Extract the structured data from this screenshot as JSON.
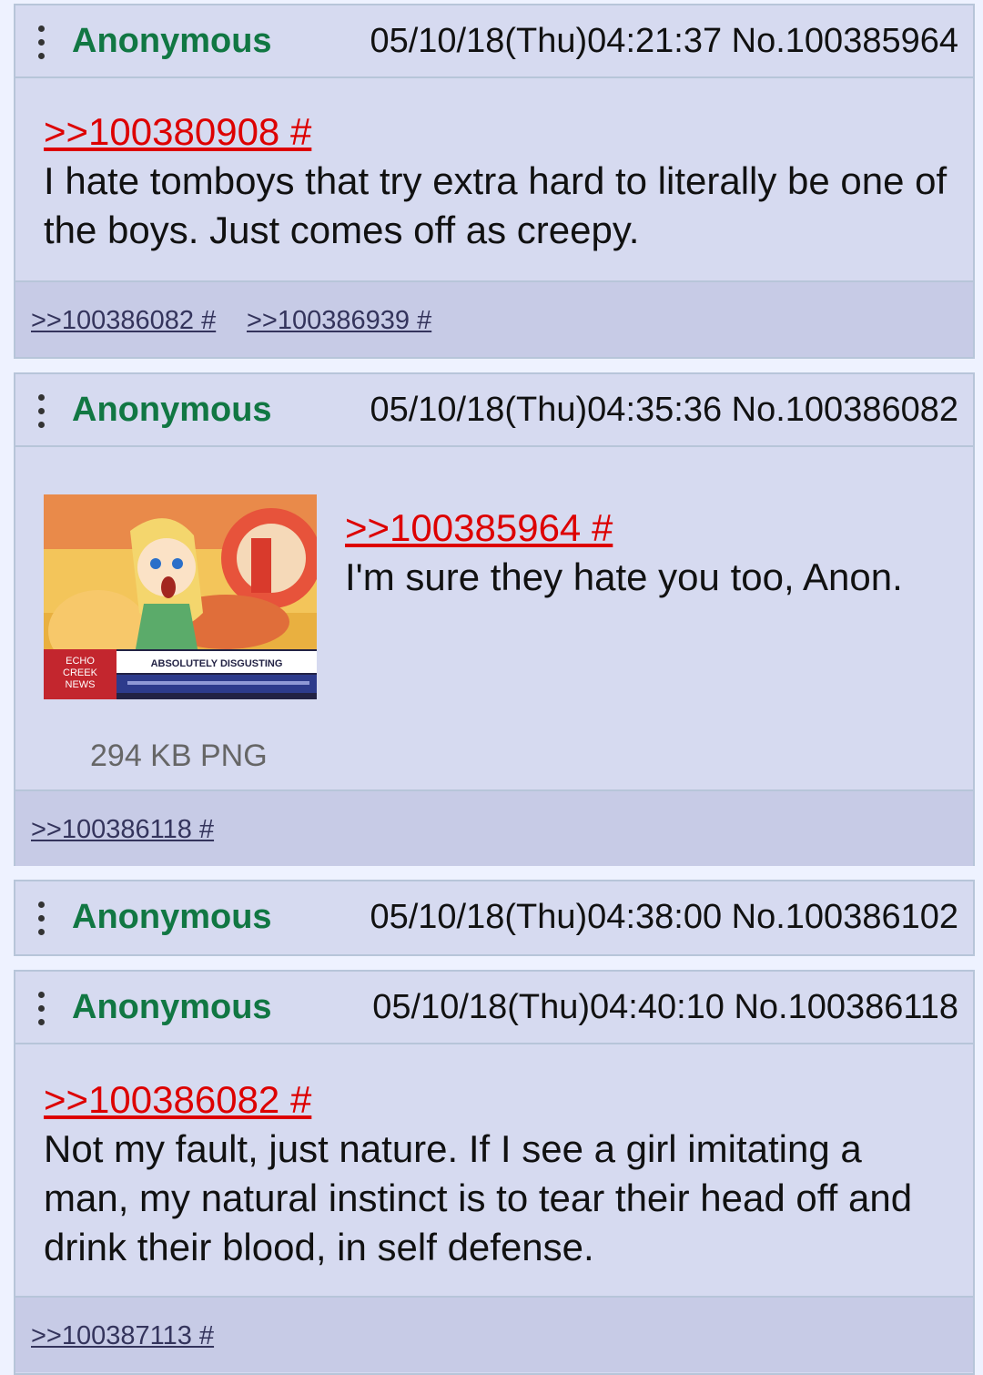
{
  "posts": [
    {
      "name": "Anonymous",
      "datetime": "05/10/18(Thu)04:21:37",
      "number": "No.100385964",
      "quote": ">>100380908 #",
      "text": "I hate tomboys that try extra hard to literally be one of the boys. Just comes off as creepy.",
      "replies": [
        ">>100386082 #",
        ">>100386939 #"
      ]
    },
    {
      "name": "Anonymous",
      "datetime": "05/10/18(Thu)04:35:36",
      "number": "No.100386082",
      "quote": ">>100385964 #",
      "text": "I'm sure they hate you too, Anon.",
      "file_info": "294 KB PNG",
      "thumbnail": {
        "logo_text": [
          "ECHO",
          "CREEK",
          "NEWS"
        ],
        "headline": "ABSOLUTELY DISGUSTING"
      },
      "replies": [
        ">>100386118 #"
      ]
    },
    {
      "name": "Anonymous",
      "datetime": "05/10/18(Thu)04:38:00",
      "number": "No.100386102"
    },
    {
      "name": "Anonymous",
      "datetime": "05/10/18(Thu)04:40:10",
      "number": "No.100386118",
      "quote": ">>100386082 #",
      "text": "Not my fault, just nature. If I see a girl imitating a man, my natural instinct is to tear their head off and drink their blood, in self defense.",
      "replies": [
        ">>100387113 #"
      ]
    }
  ],
  "colors": {
    "name": "#117743",
    "quotelink": "#dd0000",
    "post_bg": "#d6daf0",
    "footer_bg": "#c7cbe6",
    "page_bg": "#eef2ff"
  }
}
